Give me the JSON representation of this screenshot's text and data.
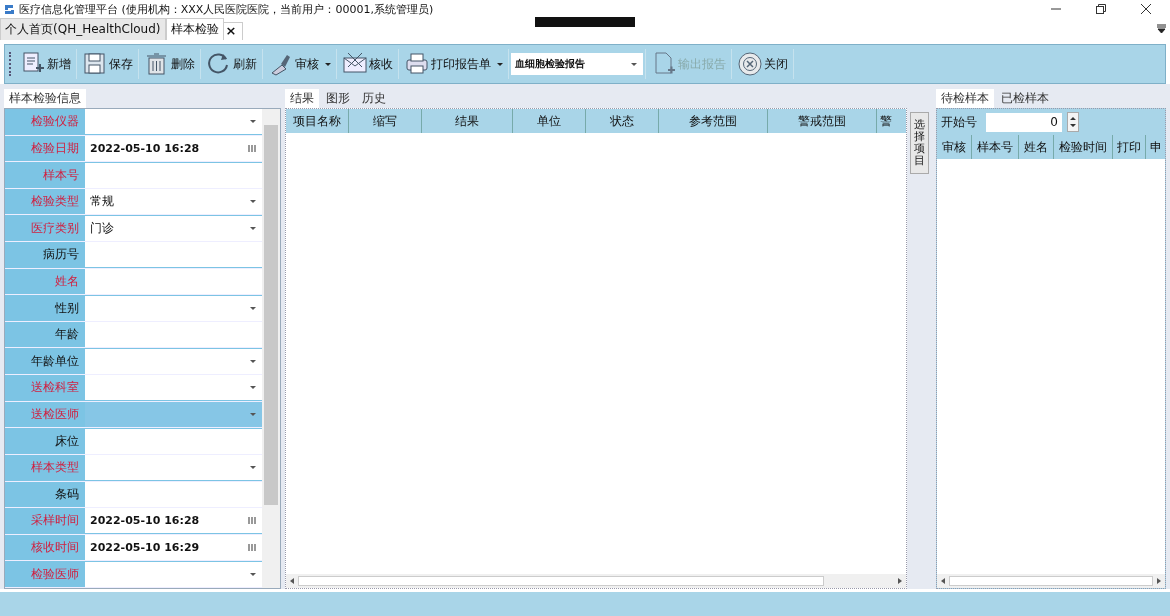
{
  "window": {
    "title": "医疗信息化管理平台 (使用机构：XXX人民医院医院，当前用户：00001,系统管理员)"
  },
  "tabs": [
    {
      "label": "个人首页(QH_HealthCloud)",
      "selected": false
    },
    {
      "label": "样本检验",
      "selected": true,
      "close": "×"
    }
  ],
  "toolbar": {
    "items": [
      {
        "kind": "button",
        "label": "新增",
        "disabled": false,
        "has_menu": false
      },
      {
        "kind": "button",
        "label": "保存",
        "disabled": false,
        "has_menu": false
      },
      {
        "kind": "button",
        "label": "删除",
        "disabled": false,
        "has_menu": false
      },
      {
        "kind": "button",
        "label": "刷新",
        "disabled": false,
        "has_menu": false
      },
      {
        "kind": "button",
        "label": "审核",
        "disabled": false,
        "has_menu": true
      },
      {
        "kind": "button",
        "label": "核收",
        "disabled": false,
        "has_menu": false
      },
      {
        "kind": "button",
        "label": "打印报告单",
        "disabled": false,
        "has_menu": true
      },
      {
        "kind": "combo",
        "value": "血细胞检验报告"
      },
      {
        "kind": "button",
        "label": "输出报告",
        "disabled": true,
        "has_menu": false
      },
      {
        "kind": "button",
        "label": "关闭",
        "disabled": false,
        "has_menu": false
      }
    ]
  },
  "sample_panel": {
    "title": "样本检验信息",
    "fields": [
      {
        "label": "检验仪器",
        "kind": "combo",
        "required": true,
        "selected": false
      },
      {
        "label": "检验日期",
        "kind": "date",
        "required": true,
        "value": "2022-05-10 16:28",
        "selected": false
      },
      {
        "label": "样本号",
        "kind": "text",
        "required": true,
        "selected": false
      },
      {
        "label": "检验类型",
        "kind": "combo",
        "required": true,
        "value": "常规",
        "selected": false
      },
      {
        "label": "医疗类别",
        "kind": "combo",
        "required": true,
        "value": "门诊",
        "selected": false
      },
      {
        "label": "病历号",
        "kind": "text",
        "required": false,
        "selected": false
      },
      {
        "label": "姓名",
        "kind": "text",
        "required": true,
        "selected": false
      },
      {
        "label": "性别",
        "kind": "combo",
        "required": false,
        "selected": false
      },
      {
        "label": "年龄",
        "kind": "text",
        "required": false,
        "selected": false
      },
      {
        "label": "年龄单位",
        "kind": "combo",
        "required": false,
        "selected": false
      },
      {
        "label": "送检科室",
        "kind": "combo",
        "required": true,
        "selected": false
      },
      {
        "label": "送检医师",
        "kind": "combo",
        "required": true,
        "selected": true
      },
      {
        "label": "床位",
        "kind": "text",
        "required": false,
        "selected": false
      },
      {
        "label": "样本类型",
        "kind": "combo",
        "required": true,
        "selected": false
      },
      {
        "label": "条码",
        "kind": "text",
        "required": false,
        "selected": false
      },
      {
        "label": "采样时间",
        "kind": "date",
        "required": true,
        "value": "2022-05-10 16:28",
        "selected": false
      },
      {
        "label": "核收时间",
        "kind": "date",
        "required": true,
        "value": "2022-05-10 16:29",
        "selected": false
      },
      {
        "label": "检验医师",
        "kind": "combo",
        "required": true,
        "selected": false
      }
    ]
  },
  "result_tabs": [
    {
      "label": "结果",
      "selected": true
    },
    {
      "label": "图形",
      "selected": false
    },
    {
      "label": "历史",
      "selected": false
    }
  ],
  "result_table": {
    "columns": [
      "项目名称",
      "缩写",
      "结果",
      "单位",
      "状态",
      "参考范围",
      "警戒范围",
      "警"
    ]
  },
  "side_tab": {
    "label": "选择项目"
  },
  "sample_tabs": [
    {
      "label": "待检样本",
      "selected": true
    },
    {
      "label": "已检样本",
      "selected": false
    }
  ],
  "start_number": {
    "label": "开始号",
    "value": "0"
  },
  "sample_table": {
    "columns": [
      "审核",
      "样本号",
      "姓名",
      "检验时间",
      "打印",
      "申"
    ]
  }
}
